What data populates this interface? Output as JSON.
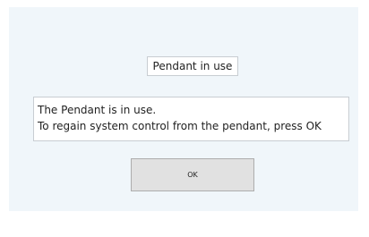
{
  "dialog": {
    "title": "Pendant in use",
    "message_lines": [
      "The Pendant is in use.",
      "To regain system control from the pendant, press OK"
    ],
    "ok_label": "OK"
  }
}
